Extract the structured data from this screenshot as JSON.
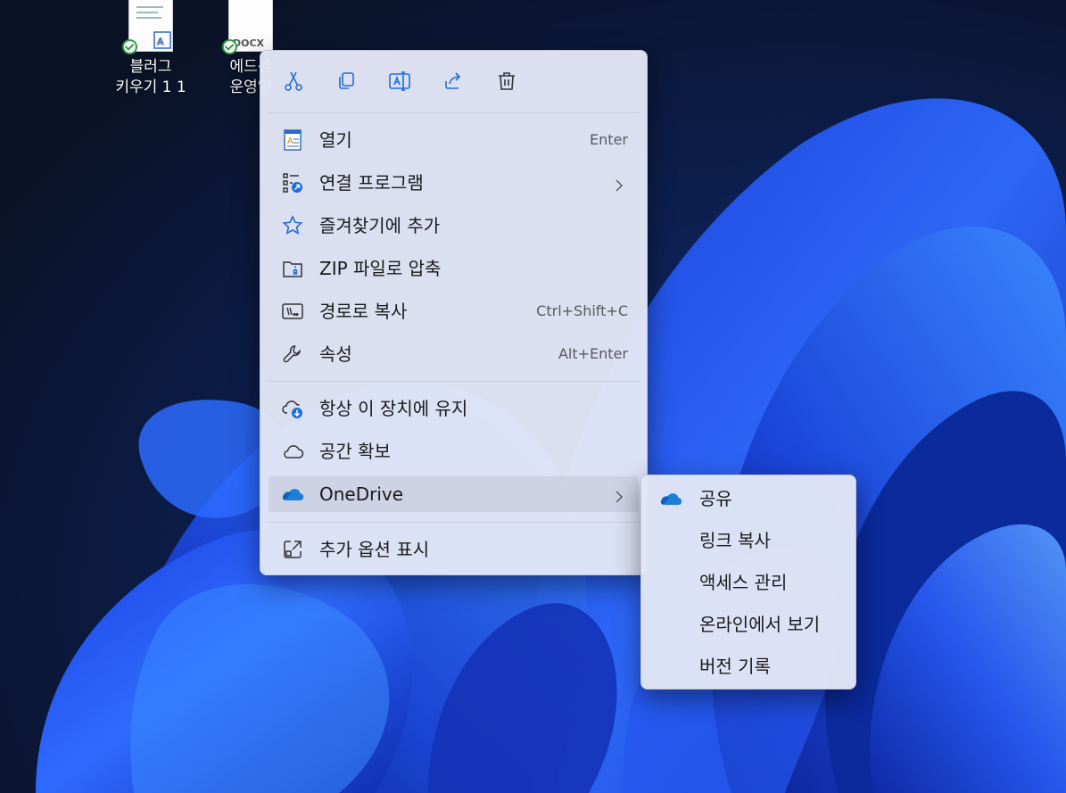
{
  "desktop": {
    "icons": [
      {
        "label": "블러그\n키우기 1 1",
        "type_tag": ""
      },
      {
        "label": "에드센\n운영일",
        "type_tag": "DOCX"
      }
    ]
  },
  "context_menu": {
    "toolbar": [
      {
        "name": "cut",
        "icon": "scissors-icon"
      },
      {
        "name": "copy",
        "icon": "copy-icon"
      },
      {
        "name": "rename",
        "icon": "rename-icon"
      },
      {
        "name": "share",
        "icon": "share-icon"
      },
      {
        "name": "delete",
        "icon": "trash-icon"
      }
    ],
    "items": [
      {
        "label": "열기",
        "shortcut": "Enter",
        "icon": "document-icon"
      },
      {
        "label": "연결 프로그램",
        "shortcut": "",
        "icon": "open-with-icon",
        "submenu": true
      },
      {
        "label": "즐겨찾기에 추가",
        "shortcut": "",
        "icon": "star-icon"
      },
      {
        "label": "ZIP 파일로 압축",
        "shortcut": "",
        "icon": "zip-folder-icon"
      },
      {
        "label": "경로로 복사",
        "shortcut": "Ctrl+Shift+C",
        "icon": "copy-path-icon"
      },
      {
        "label": "속성",
        "shortcut": "Alt+Enter",
        "icon": "wrench-icon"
      },
      {
        "label": "항상 이 장치에 유지",
        "shortcut": "",
        "icon": "cloud-download-icon"
      },
      {
        "label": "공간 확보",
        "shortcut": "",
        "icon": "cloud-icon"
      },
      {
        "label": "OneDrive",
        "shortcut": "",
        "icon": "onedrive-icon",
        "submenu": true
      },
      {
        "label": "추가 옵션 표시",
        "shortcut": "",
        "icon": "more-options-icon"
      }
    ]
  },
  "onedrive_submenu": {
    "items": [
      {
        "label": "공유",
        "icon": "onedrive-icon"
      },
      {
        "label": "링크 복사"
      },
      {
        "label": "액세스 관리"
      },
      {
        "label": "온라인에서 보기"
      },
      {
        "label": "버전 기록"
      }
    ]
  },
  "colors": {
    "menu_bg": "#e2e6f6",
    "accent": "#1f6fd6",
    "onedrive": "#1e7fd8",
    "wallpaper_dark": "#0b1630",
    "wallpaper_blue": "#1f4fe8"
  }
}
